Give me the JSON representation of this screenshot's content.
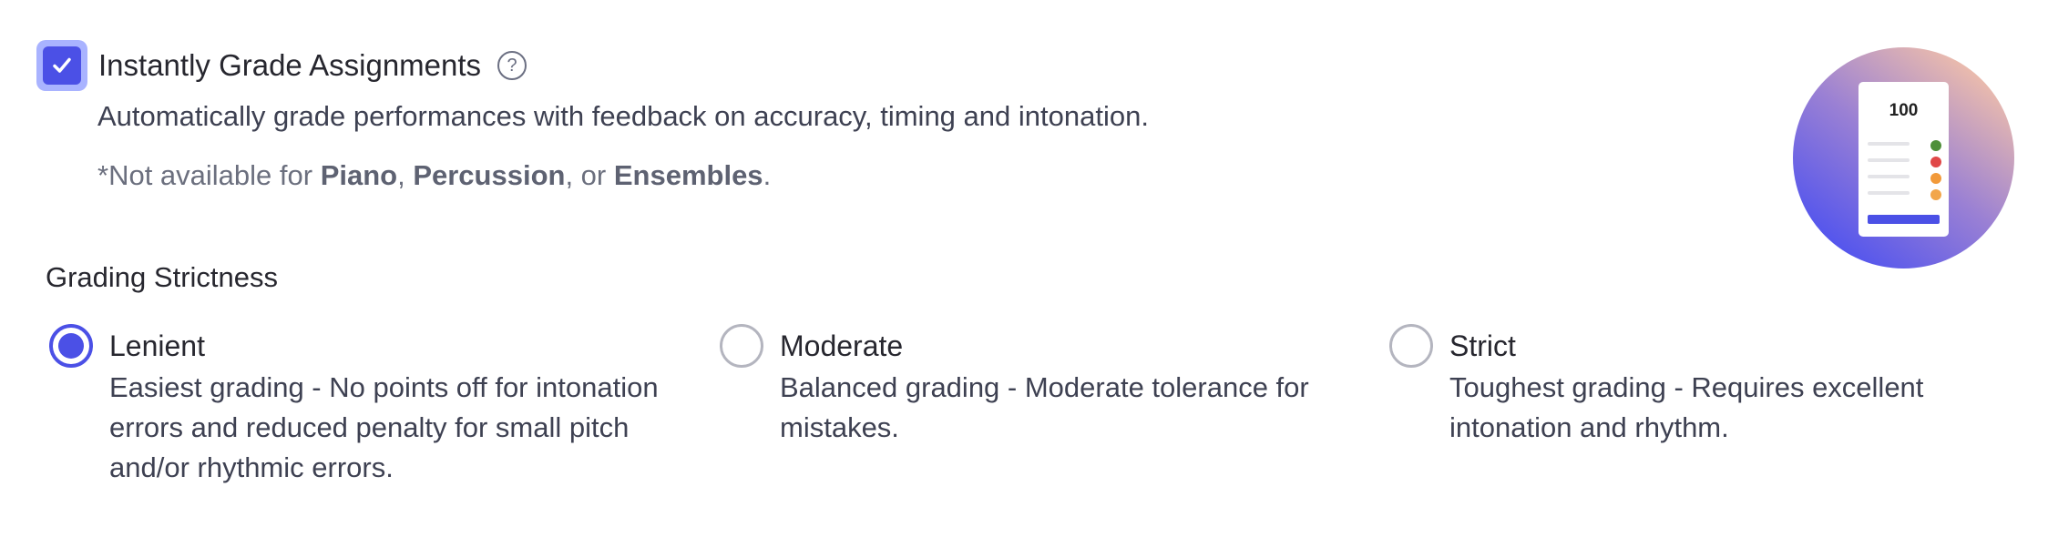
{
  "instant_grade": {
    "checked": true,
    "title": "Instantly Grade Assignments",
    "help_icon": "question-circle-icon",
    "help_glyph": "?",
    "description": "Automatically grade performances with feedback on accuracy, timing and intonation.",
    "note": {
      "prefix": "*Not available for ",
      "item1": "Piano",
      "sep1": ", ",
      "item2": "Percussion",
      "sep2": ", or ",
      "item3": "Ensembles",
      "suffix": "."
    }
  },
  "illustration": {
    "score": "100",
    "indicator_colors": [
      "#4f8f3a",
      "#e04848",
      "#f29a3a",
      "#f2a64a"
    ]
  },
  "grading_strictness": {
    "title": "Grading Strictness",
    "selected": "Lenient",
    "options": [
      {
        "label": "Lenient",
        "desc_lines": [
          "Easiest grading - No points off for intonation",
          "errors and reduced penalty for small pitch",
          "and/or rhythmic errors."
        ]
      },
      {
        "label": "Moderate",
        "desc_lines": [
          "Balanced grading - Moderate tolerance for",
          "mistakes."
        ]
      },
      {
        "label": "Strict",
        "desc_lines": [
          "Toughest grading - Requires excellent",
          "intonation and rhythm."
        ]
      }
    ]
  },
  "colors": {
    "accent": "#4b50e6",
    "checkbox_ring": "#a9b3ff"
  }
}
